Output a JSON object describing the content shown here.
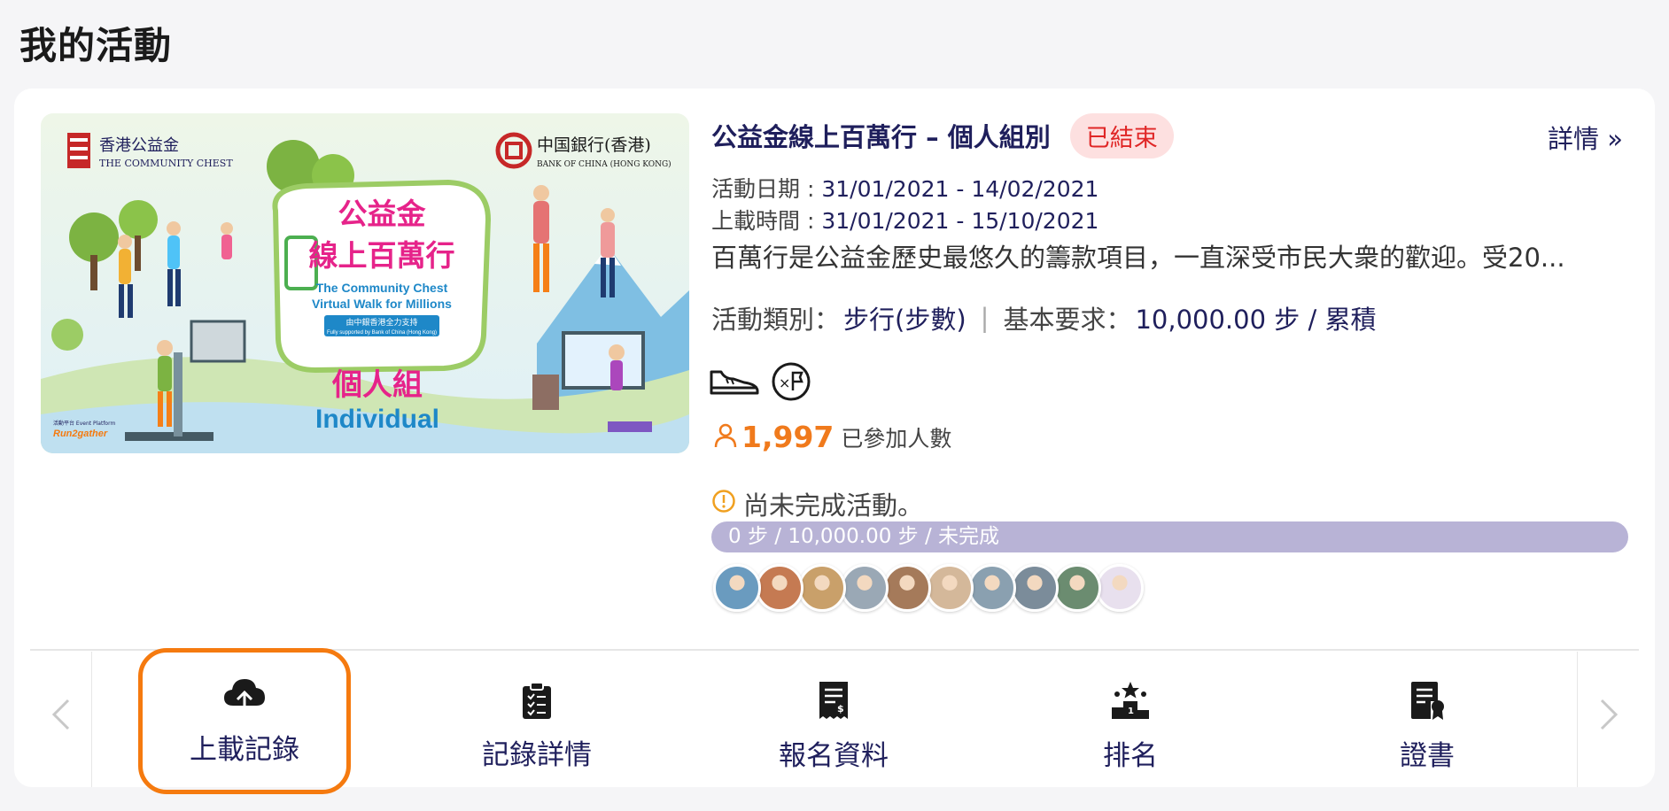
{
  "page": {
    "title": "我的活動"
  },
  "banner": {
    "org_left_cn": "香港公益金",
    "org_left_en": "THE COMMUNITY CHEST",
    "org_right_cn": "中国銀行(香港)",
    "org_right_en": "BANK OF CHINA (HONG KONG)",
    "main_cn_1": "公益金",
    "main_cn_2": "線上百萬行",
    "main_en_1": "The Community Chest",
    "main_en_2": "Virtual Walk for Millions",
    "support_cn": "由中銀香港全力支持",
    "support_en": "Fully supported by Bank of China (Hong Kong)",
    "group_cn": "個人組",
    "group_en": "Individual",
    "platform_label": "活動平台 Event Platform",
    "platform_name": "Run2gather"
  },
  "event": {
    "title": "公益金線上百萬行 – 個人組別",
    "status": "已結束",
    "details_link": "詳情 »",
    "date_label": "活動日期 : ",
    "date_value": "31/01/2021 - 14/02/2021",
    "upload_label": "上載時間 : ",
    "upload_value": "31/01/2021 - 15/10/2021",
    "description": "百萬行是公益金歷史最悠久的籌款項目，一直深受市民大衆的歡迎。受20...",
    "category_label": "活動類別：",
    "category_value": "步行(步數)",
    "requirement_label": "基本要求：",
    "requirement_value": "10,000.00 步 / 累積",
    "icons": [
      "shoe-icon",
      "multiplier-flag-icon"
    ],
    "participant_count": "1,997",
    "participant_label": "已參加人數",
    "warning_text": "尚未完成活動。",
    "progress_text": "0 步 / 10,000.00 步 / 未完成",
    "progress_fraction": 0
  },
  "avatars": [
    {
      "color": "#6a9bbf"
    },
    {
      "color": "#c57a52"
    },
    {
      "color": "#c9a06a"
    },
    {
      "color": "#9aa8b5"
    },
    {
      "color": "#a57a5a"
    },
    {
      "color": "#d4b89a"
    },
    {
      "color": "#8aa0b0"
    },
    {
      "color": "#7b8c9a"
    },
    {
      "color": "#6b8c70"
    },
    {
      "color": "#e8e0ee"
    }
  ],
  "actions": [
    {
      "label": "上載記錄",
      "icon": "cloud-upload-icon",
      "selected": true
    },
    {
      "label": "記錄詳情",
      "icon": "clipboard-check-icon",
      "selected": false
    },
    {
      "label": "報名資料",
      "icon": "receipt-icon",
      "selected": false
    },
    {
      "label": "排名",
      "icon": "ranking-podium-icon",
      "selected": false
    },
    {
      "label": "證書",
      "icon": "certificate-icon",
      "selected": false
    }
  ],
  "colors": {
    "accent": "#f57a0f",
    "status_bg": "#fde0e0",
    "status_text": "#e02626",
    "progress_bg": "#b8b3d6",
    "navy": "#1f1f5c",
    "pink": "#e6238a",
    "blue": "#1e88c8"
  }
}
